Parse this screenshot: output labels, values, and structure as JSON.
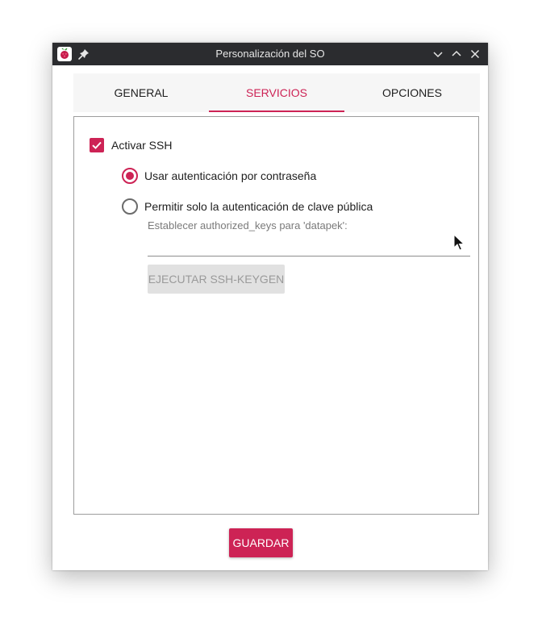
{
  "window": {
    "title": "Personalización del SO",
    "icons": [
      "raspberry-pi-icon",
      "pin-icon",
      "minimize-icon",
      "maximize-icon",
      "close-icon"
    ]
  },
  "tabs": [
    {
      "label": "GENERAL",
      "active": false
    },
    {
      "label": "SERVICIOS",
      "active": true
    },
    {
      "label": "OPCIONES",
      "active": false
    }
  ],
  "ssh": {
    "enable_label": "Activar SSH",
    "enabled": true,
    "auth_options": [
      {
        "label": "Usar autenticación por contraseña",
        "selected": true
      },
      {
        "label": "Permitir solo la autenticación de clave pública",
        "selected": false
      }
    ],
    "authorized_keys_label": "Establecer authorized_keys para 'datapek':",
    "authorized_keys_value": "",
    "keygen_button": "EJECUTAR SSH-KEYGEN"
  },
  "footer": {
    "save_button": "GUARDAR"
  },
  "colors": {
    "accent": "#cd2355",
    "titlebar": "#2b2c2f",
    "tab_background": "#f6f6f6",
    "disabled_button": "#e1e1e1"
  }
}
